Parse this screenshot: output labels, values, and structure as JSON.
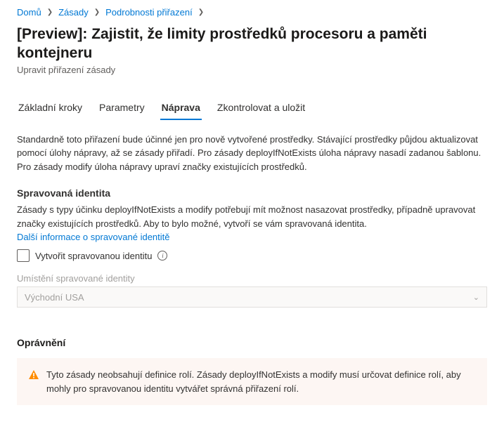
{
  "breadcrumb": {
    "home": "Domů",
    "policies": "Zásady",
    "details": "Podrobnosti přiřazení"
  },
  "page_title": "[Preview]: Zajistit, že limity prostředků procesoru a paměti kontejneru",
  "page_subtitle": "Upravit přiřazení zásady",
  "tabs": {
    "basic": "Základní kroky",
    "params": "Parametry",
    "remediation": "Náprava",
    "review": "Zkontrolovat a uložit"
  },
  "intro_text": "Standardně toto přiřazení bude účinné jen pro nově vytvořené prostředky. Stávající prostředky půjdou aktualizovat pomocí úlohy nápravy, až se zásady přiřadí. Pro zásady deployIfNotExists úloha nápravy nasadí zadanou šablonu. Pro zásady modify úloha nápravy upraví značky existujících prostředků.",
  "managed_identity": {
    "heading": "Spravovaná identita",
    "desc": "Zásady s typy účinku deployIfNotExists a modify potřebují mít možnost nasazovat prostředky, případně upravovat značky existujících prostředků. Aby to bylo možné, vytvoří se vám spravovaná identita.",
    "link": "Další informace o spravované identitě",
    "checkbox_label": "Vytvořit spravovanou identitu",
    "location_label": "Umístění spravované identity",
    "location_value": "Východní USA"
  },
  "permissions": {
    "heading": "Oprávnění",
    "warning": "Tyto zásady neobsahují definice rolí. Zásady deployIfNotExists a modify musí určovat definice rolí, aby mohly pro spravovanou identitu vytvářet správná přiřazení rolí."
  }
}
